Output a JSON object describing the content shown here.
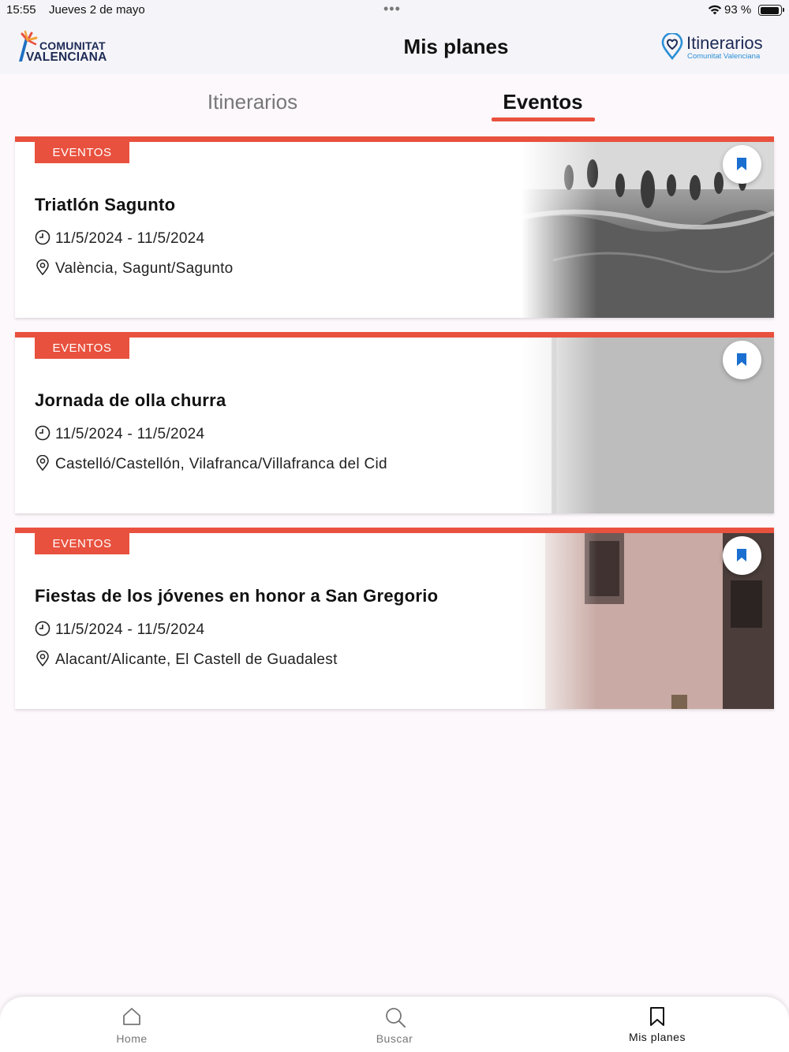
{
  "status_bar": {
    "time": "15:55",
    "date": "Jueves 2 de mayo",
    "battery": "93 %",
    "battery_level": 0.93
  },
  "header": {
    "title": "Mis planes",
    "logo_left": {
      "line1": "COMUNITAT",
      "line2": "VALENCIANA"
    },
    "logo_right": {
      "name": "Itinerarios",
      "sub": "Comunitat Valenciana"
    }
  },
  "tabs": [
    {
      "label": "Itinerarios",
      "active": false
    },
    {
      "label": "Eventos",
      "active": true
    }
  ],
  "events": [
    {
      "badge": "EVENTOS",
      "title": "Triatlón Sagunto",
      "dates": "11/5/2024 - 11/5/2024",
      "place": "València, Sagunt/Sagunto"
    },
    {
      "badge": "EVENTOS",
      "title": "Jornada de olla churra",
      "dates": "11/5/2024 - 11/5/2024",
      "place": "Castelló/Castellón, Vilafranca/Villafranca del Cid"
    },
    {
      "badge": "EVENTOS",
      "title": "Fiestas de los jóvenes en honor a San Gregorio",
      "dates": "11/5/2024 - 11/5/2024",
      "place": "Alacant/Alicante, El Castell de Guadalest"
    }
  ],
  "bottom_nav": [
    {
      "label": "Home",
      "icon": "home-icon",
      "active": false
    },
    {
      "label": "Buscar",
      "icon": "search-icon",
      "active": false
    },
    {
      "label": "Mis planes",
      "icon": "bookmark-icon",
      "active": true
    }
  ],
  "colors": {
    "accent": "#e8513e",
    "bookmark": "#1a6fd0",
    "brand_navy": "#1c2a55"
  }
}
